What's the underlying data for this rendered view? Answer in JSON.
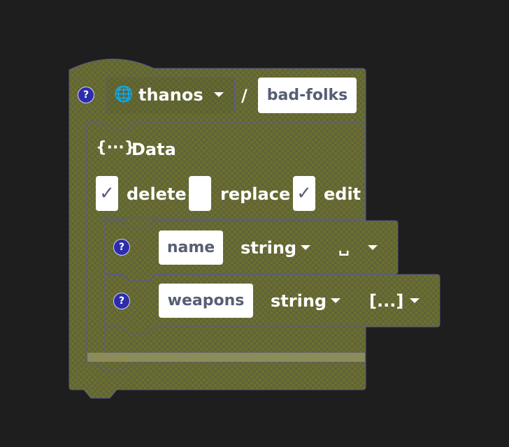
{
  "colors": {
    "background": "#1e1e1e",
    "block_fill": "#6e6e2e",
    "block_stroke": "#5a5a8a",
    "help_fill": "#2d2dab",
    "field_text": "#575e75"
  },
  "collection_block": {
    "help": "?",
    "source_icon": "globe-icon",
    "source_label": "thanos",
    "separator": "/",
    "collection_name": "bad-folks"
  },
  "data_block": {
    "icon_text": "{···}",
    "title": "Data",
    "options": [
      {
        "label": "delete",
        "checked": true,
        "mark": "✓"
      },
      {
        "label": "replace",
        "checked": false,
        "mark": ""
      },
      {
        "label": "edit",
        "checked": true,
        "mark": "✓"
      }
    ]
  },
  "fields": [
    {
      "help": "?",
      "name": "name",
      "type": "string",
      "mode": "␣"
    },
    {
      "help": "?",
      "name": "weapons",
      "type": "string",
      "mode": "[...]"
    }
  ]
}
